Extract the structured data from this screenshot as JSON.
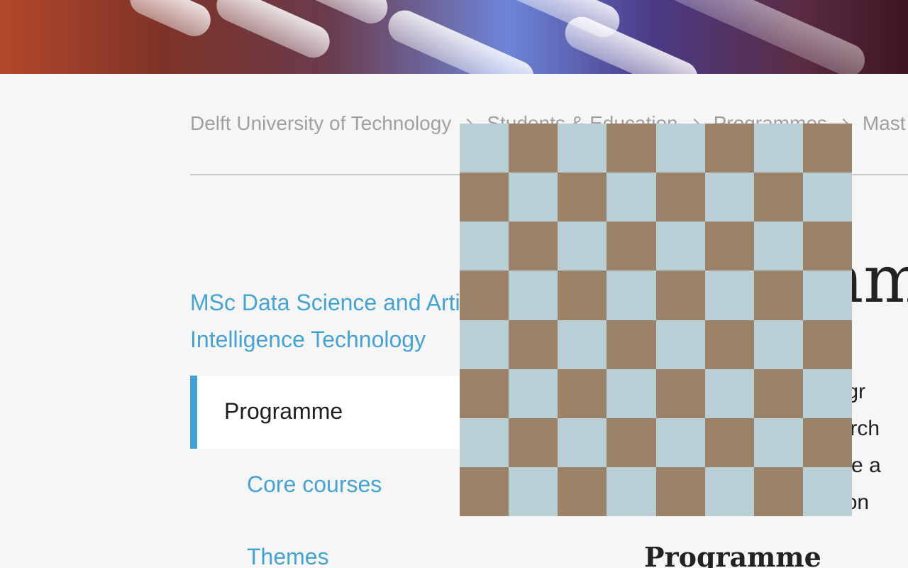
{
  "breadcrumb": {
    "items": [
      "Delft University of Technology",
      "Students & Education",
      "Programmes",
      "Mast"
    ]
  },
  "sidebar": {
    "title": "MSc Data Science and Artificial Intelligence Technology",
    "title_visible": "MSc Data Science and Arti\nIntelligence Technology",
    "items": [
      {
        "label": "Programme",
        "active": true
      },
      {
        "label": "Core courses",
        "active": false
      },
      {
        "label": "Themes",
        "active": false
      }
    ]
  },
  "main": {
    "heading_fragment": "mm",
    "text_lines": [
      "progr",
      "search",
      "edge a",
      "ou on"
    ],
    "section_heading": "Programme"
  },
  "overlay": {
    "type": "checkerboard",
    "grid_size": 8,
    "colors": {
      "light": "#b8cfd5",
      "dark": "#9a8167"
    }
  },
  "colors": {
    "accent": "#45a3d3",
    "background": "#f6f6f6",
    "breadcrumb_text": "#a0a0a0"
  }
}
